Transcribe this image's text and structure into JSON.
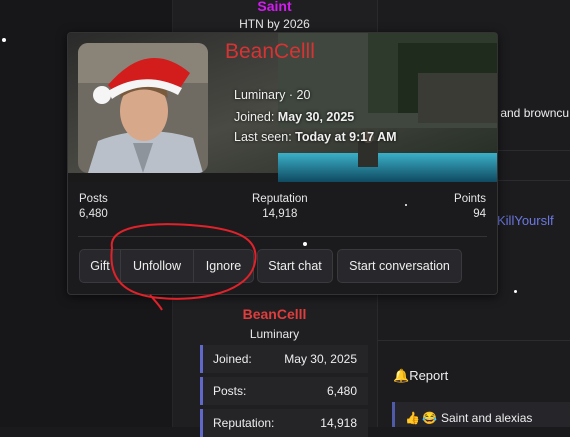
{
  "top_user": {
    "name": "Saint",
    "title": "HTN by 2026"
  },
  "card": {
    "username": "BeanCelll",
    "rank_line": "Luminary · 20",
    "joined_label": "Joined:",
    "joined_value": "May 30, 2025",
    "last_seen_label": "Last seen:",
    "last_seen_value": "Today at 9:17 AM",
    "stats": [
      {
        "label": "Posts",
        "value": "6,480"
      },
      {
        "label": "Reputation",
        "value": "14,918"
      },
      {
        "label": "Points",
        "value": "94"
      }
    ],
    "buttons": [
      "Gift",
      "Unfollow",
      "Ignore",
      "Start chat",
      "Start conversation"
    ]
  },
  "right_panel": {
    "snippet": "s and browncu",
    "link": "KillYourslf",
    "report": "Report",
    "reactions": "Saint and alexias",
    "reaction_emojis": [
      "👍",
      "😂"
    ]
  },
  "post_author": {
    "name": "BeanCelll",
    "title": "Luminary",
    "rows": [
      {
        "key": "Joined:",
        "value": "May 30, 2025"
      },
      {
        "key": "Posts:",
        "value": "6,480"
      },
      {
        "key": "Reputation:",
        "value": "14,918"
      }
    ]
  },
  "colors": {
    "accent_name": "#d83333",
    "top_name": "#d21cf0",
    "link": "#6b78e0",
    "annotation": "#e0222a"
  }
}
